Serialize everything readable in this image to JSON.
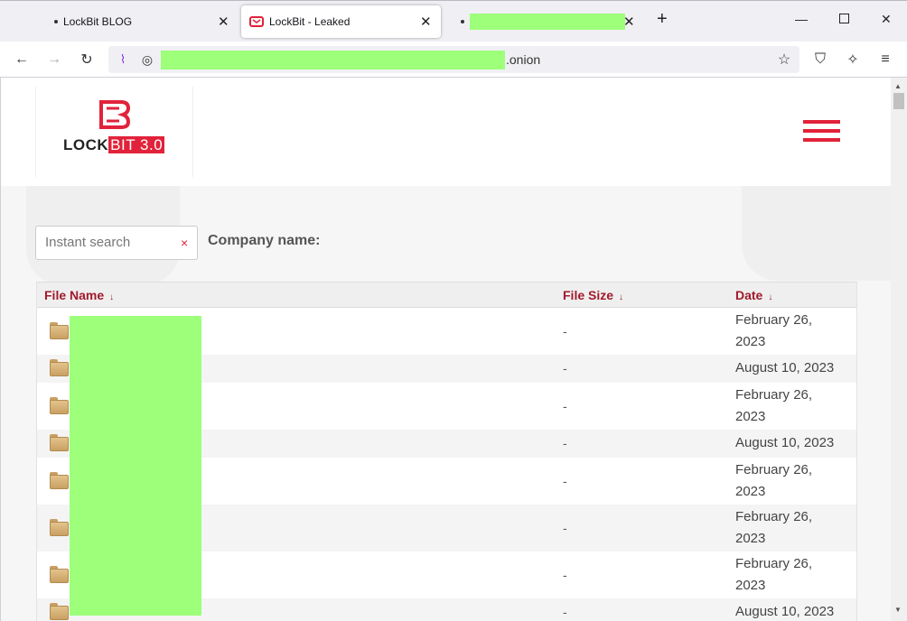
{
  "browser": {
    "tabs": [
      {
        "title": "LockBit BLOG",
        "active": false
      },
      {
        "title": "LockBit - Leaked",
        "active": true
      },
      {
        "title": "",
        "active": false
      }
    ],
    "new_tab": "+",
    "url_suffix": ".onion"
  },
  "site": {
    "logo": {
      "part1": "LOCK",
      "part2": "BIT 3.0"
    },
    "search_placeholder": "Instant search",
    "search_clear": "×",
    "company_label": "Company name:"
  },
  "table": {
    "columns": [
      {
        "label": "File Name",
        "arrow": "↓"
      },
      {
        "label": "File Size",
        "arrow": "↓"
      },
      {
        "label": "Date",
        "arrow": "↓"
      }
    ],
    "rows": [
      {
        "size": "-",
        "date": "February 26, 2023"
      },
      {
        "size": "-",
        "date": "August 10, 2023"
      },
      {
        "size": "-",
        "date": "February 26, 2023"
      },
      {
        "size": "-",
        "date": "August 10, 2023"
      },
      {
        "size": "-",
        "date": "February 26, 2023"
      },
      {
        "size": "-",
        "date": "February 26, 2023"
      },
      {
        "size": "-",
        "date": "February 26, 2023"
      },
      {
        "size": "-",
        "date": "August 10, 2023"
      }
    ]
  },
  "colors": {
    "brand_red": "#e1223a",
    "header_red": "#a11a2b",
    "redaction": "#9dff7a"
  }
}
